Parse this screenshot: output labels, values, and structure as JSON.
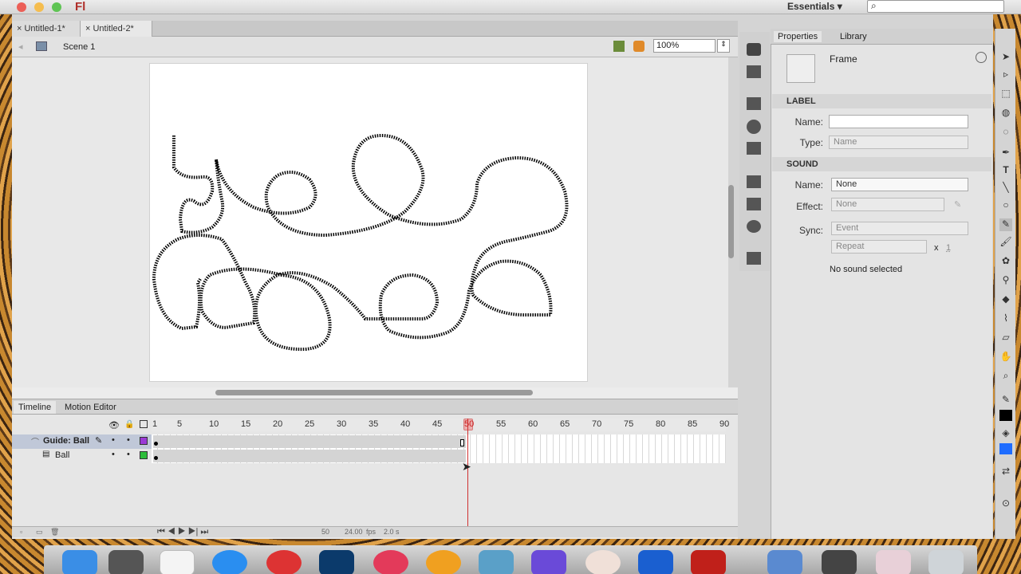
{
  "app": {
    "logo": "Fl",
    "workspace": "Essentials",
    "search_icon": "⌕"
  },
  "documents": [
    "Untitled-1*",
    "Untitled-2*"
  ],
  "editbar": {
    "scene": "Scene 1",
    "zoom": "100%"
  },
  "timeline": {
    "tabs": [
      "Timeline",
      "Motion Editor"
    ],
    "ruler": [
      "1",
      "5",
      "10",
      "15",
      "20",
      "25",
      "30",
      "35",
      "40",
      "45",
      "50",
      "55",
      "60",
      "65",
      "70",
      "75",
      "80",
      "85",
      "90"
    ],
    "layers": [
      {
        "name": "Guide: Ball",
        "color": "#9b3ad6"
      },
      {
        "name": "Ball",
        "color": "#2dbd3a"
      }
    ],
    "status": {
      "frame": "50",
      "fps": "24.00",
      "fps_unit": "fps",
      "time": "2.0 s"
    }
  },
  "properties": {
    "tabs": [
      "Properties",
      "Library"
    ],
    "object": "Frame",
    "label": {
      "header": "LABEL",
      "name_label": "Name:",
      "name_value": "",
      "type_label": "Type:",
      "type_value": "Name"
    },
    "sound": {
      "header": "SOUND",
      "name_label": "Name:",
      "name_value": "None",
      "effect_label": "Effect:",
      "effect_value": "None",
      "sync_label": "Sync:",
      "sync_value": "Event",
      "repeat_value": "Repeat",
      "times": "x",
      "count": "1",
      "status": "No sound selected"
    }
  },
  "colors": {
    "accent": "#d03030"
  }
}
